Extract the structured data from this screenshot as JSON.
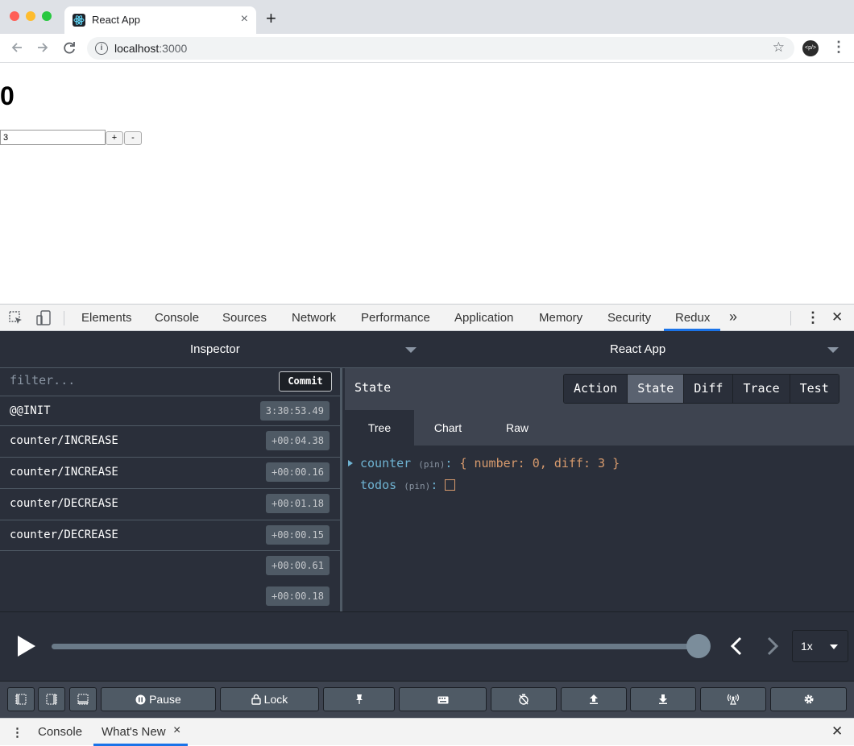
{
  "browser": {
    "tab_title": "React App",
    "tab_close": "×",
    "new_tab": "+",
    "url_host": "localhost",
    "url_port": ":3000"
  },
  "page": {
    "count": "0",
    "amount_value": "3",
    "plus_label": "+",
    "minus_label": "-"
  },
  "devtools": {
    "tabs": [
      "Elements",
      "Console",
      "Sources",
      "Network",
      "Performance",
      "Application",
      "Memory",
      "Security",
      "Redux"
    ],
    "active_tab": "Redux",
    "more": "»",
    "close": "✕",
    "menu": "⋮"
  },
  "redux": {
    "monitor": "Inspector",
    "store": "React App",
    "filter_placeholder": "filter...",
    "commit_label": "Commit",
    "actions": [
      {
        "name": "@@INIT",
        "time": "3:30:53.49"
      },
      {
        "name": "counter/INCREASE",
        "time": "+00:04.38"
      },
      {
        "name": "counter/INCREASE",
        "time": "+00:00.16"
      },
      {
        "name": "counter/DECREASE",
        "time": "+00:01.18"
      },
      {
        "name": "counter/DECREASE",
        "time": "+00:00.15"
      },
      {
        "name": "",
        "time": "+00:00.61"
      },
      {
        "name": "",
        "time": "+00:00.18"
      }
    ],
    "state_title": "State",
    "modes": [
      "Action",
      "State",
      "Diff",
      "Trace",
      "Test"
    ],
    "active_mode": "State",
    "subtabs": [
      "Tree",
      "Chart",
      "Raw"
    ],
    "active_subtab": "Tree",
    "tree": {
      "counter_key": "counter",
      "counter_pin": "(pin)",
      "counter_colon": ":",
      "counter_value": "{ number: 0, diff: 3 }",
      "todos_key": "todos",
      "todos_pin": "(pin)",
      "todos_colon": ":"
    },
    "slider": {
      "progress": 1.0,
      "speed": "1x"
    },
    "buttons": {
      "pause": "Pause",
      "lock": "Lock"
    }
  },
  "drawer": {
    "tabs": [
      "Console",
      "What's New"
    ],
    "active": "What's New",
    "tab_close": "×",
    "close": "✕",
    "menu": "⋮"
  },
  "colors": {
    "accent_blue": "#1a73e8",
    "redux_bg": "#2a2f3a",
    "tree_key": "#6fb3d2",
    "tree_value": "#d89b6d"
  }
}
